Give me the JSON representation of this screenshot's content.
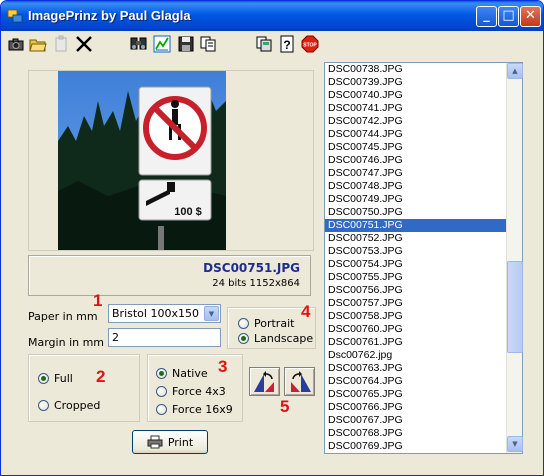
{
  "window": {
    "title": "ImagePrinz by Paul Glagla",
    "minimize": "_",
    "maximize": "□",
    "close": "✕"
  },
  "toolbar": {
    "icons": [
      "camera-icon",
      "open-folder-icon",
      "paste-icon",
      "cut-icon",
      "find-icon",
      "adjust-icon",
      "save-icon",
      "copy-icon",
      "copy-pages-icon",
      "help-icon",
      "stop-icon"
    ]
  },
  "preview": {
    "filename": "DSC00751.JPG",
    "details": "24 bits 1152x864"
  },
  "paper": {
    "label": "Paper in mm",
    "value": "Bristol 100x150",
    "number": "1"
  },
  "margin": {
    "label": "Margin in mm",
    "value": "2"
  },
  "orientation": {
    "portrait": "Portrait",
    "landscape": "Landscape",
    "selected": "Landscape",
    "number": "4"
  },
  "scale": {
    "full": "Full",
    "cropped": "Cropped",
    "selected": "Full",
    "number": "2"
  },
  "ratio": {
    "native": "Native",
    "force4x3": "Force 4x3",
    "force16x9": "Force 16x9",
    "selected": "Native",
    "number": "3"
  },
  "rotate": {
    "number": "5"
  },
  "print": {
    "label": "Print"
  },
  "files": {
    "items": [
      "DSC00738.JPG",
      "DSC00739.JPG",
      "DSC00740.JPG",
      "DSC00741.JPG",
      "DSC00742.JPG",
      "DSC00744.JPG",
      "DSC00745.JPG",
      "DSC00746.JPG",
      "DSC00747.JPG",
      "DSC00748.JPG",
      "DSC00749.JPG",
      "DSC00750.JPG",
      "DSC00751.JPG",
      "DSC00752.JPG",
      "DSC00753.JPG",
      "DSC00754.JPG",
      "DSC00755.JPG",
      "DSC00756.JPG",
      "DSC00757.JPG",
      "DSC00758.JPG",
      "DSC00760.JPG",
      "DSC00761.JPG",
      "Dsc00762.jpg",
      "DSC00763.JPG",
      "DSC00764.JPG",
      "DSC00765.JPG",
      "DSC00766.JPG",
      "DSC00767.JPG",
      "DSC00768.JPG",
      "DSC00769.JPG"
    ],
    "selected": "DSC00751.JPG"
  }
}
